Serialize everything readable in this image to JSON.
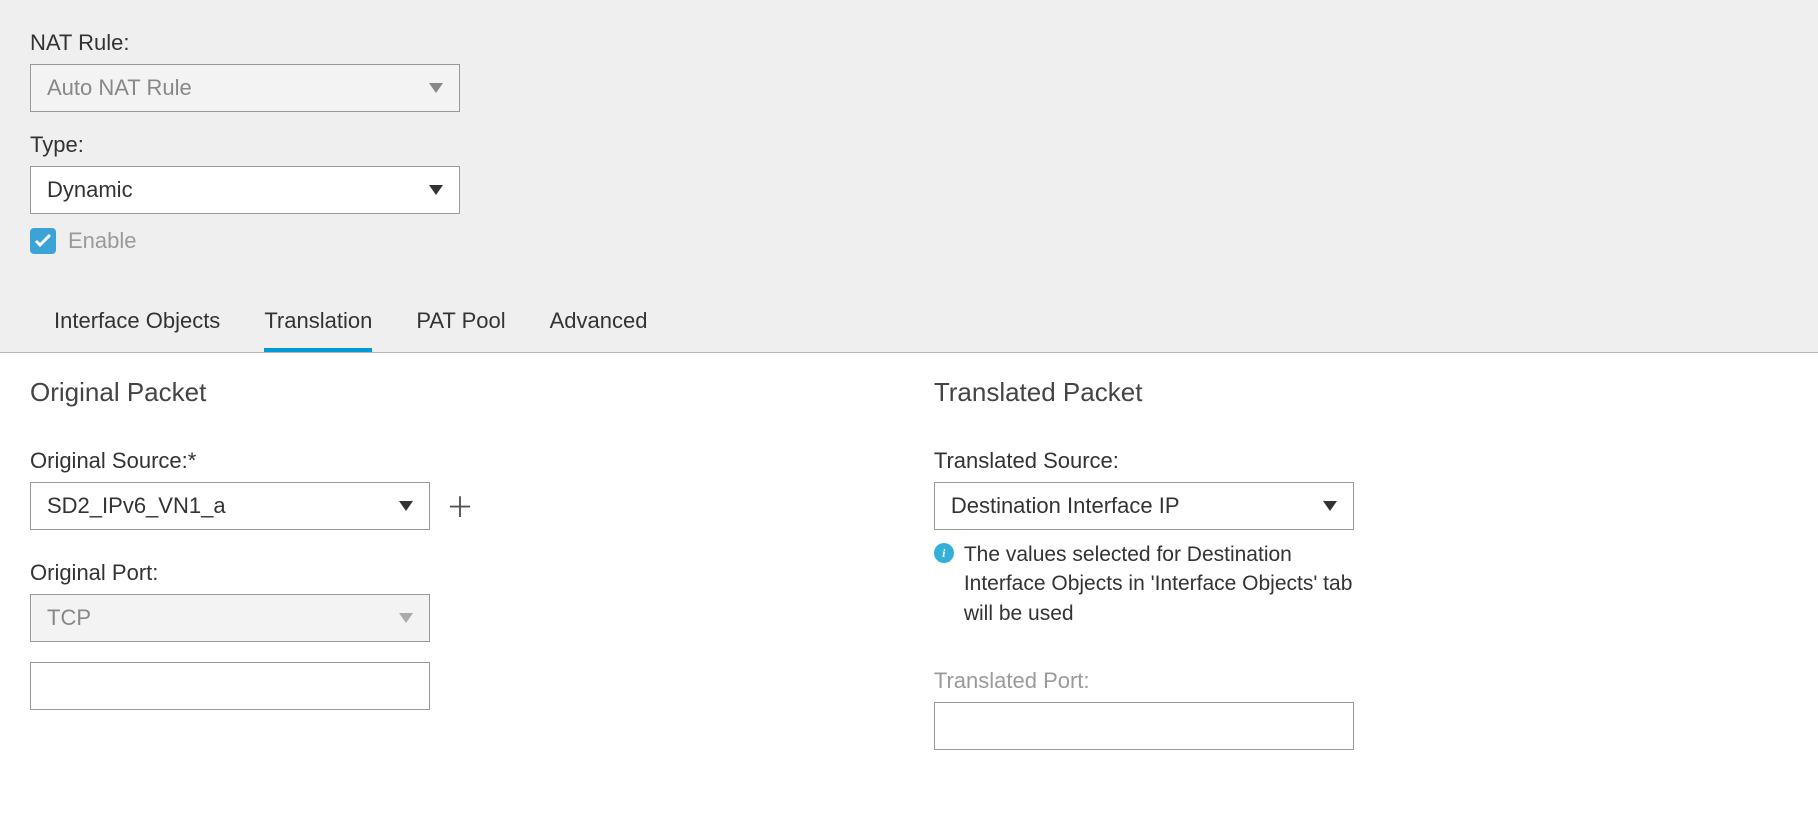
{
  "nat_rule": {
    "label": "NAT Rule:",
    "value": "Auto NAT Rule"
  },
  "type": {
    "label": "Type:",
    "value": "Dynamic"
  },
  "enable": {
    "label": "Enable"
  },
  "tabs": {
    "interface_objects": "Interface Objects",
    "translation": "Translation",
    "pat_pool": "PAT Pool",
    "advanced": "Advanced"
  },
  "original": {
    "title": "Original Packet",
    "source_label": "Original Source:*",
    "source_value": "SD2_IPv6_VN1_a",
    "port_label": "Original Port:",
    "port_value": "TCP"
  },
  "translated": {
    "title": "Translated Packet",
    "source_label": "Translated Source:",
    "source_value": "Destination Interface IP",
    "info_text": "The values selected for Destination Interface Objects in 'Interface Objects' tab will be used",
    "port_label": "Translated Port:"
  }
}
